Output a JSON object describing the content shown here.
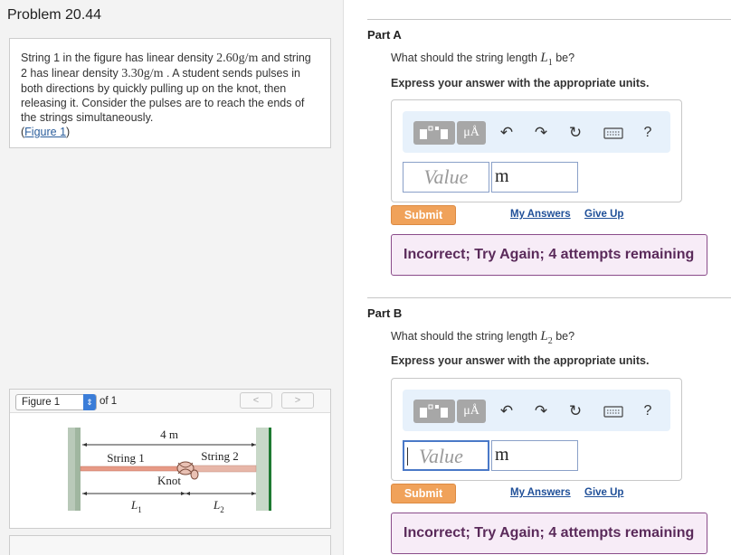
{
  "problem": {
    "title": "Problem 20.44",
    "text_1": "String 1 in the figure has linear density ",
    "density_1": "2.60g/m",
    "text_2": " and string 2 has linear density ",
    "density_2": "3.30g/m",
    "text_3": " . A student sends pulses in both directions by quickly pulling up on the knot, then releasing it. Consider the pulses are to reach the ends of the strings simultaneously.",
    "figure_link": "Figure 1"
  },
  "figure_panel": {
    "selected": "Figure 1",
    "of_label": "of 1",
    "prev": "<",
    "next": ">",
    "length_label": "4 m",
    "string1_label": "String 1",
    "string2_label": "String 2",
    "knot_label": "Knot",
    "L1_label": "L",
    "L1_sub": "1",
    "L2_label": "L",
    "L2_sub": "2"
  },
  "part_a": {
    "title": "Part A",
    "question_pre": "What should the string length ",
    "var": "L",
    "var_sub": "1",
    "question_post": " be?",
    "express": "Express your answer with the appropriate units.",
    "value_placeholder": "Value",
    "unit_value": "m",
    "submit": "Submit",
    "my_answers": "My Answers",
    "give_up": "Give Up",
    "feedback": "Incorrect; Try Again; 4 attempts remaining"
  },
  "part_b": {
    "title": "Part B",
    "question_pre": "What should the string length ",
    "var": "L",
    "var_sub": "2",
    "question_post": " be?",
    "express": "Express your answer with the appropriate units.",
    "value_placeholder": "Value",
    "unit_value": "m",
    "submit": "Submit",
    "my_answers": "My Answers",
    "give_up": "Give Up",
    "feedback": "Incorrect; Try Again; 4 attempts remaining"
  },
  "toolbar": {
    "mu_label": "μÅ",
    "undo_icon": "undo-icon",
    "redo_icon": "redo-icon",
    "reset_icon": "reset-icon",
    "keyboard_icon": "keyboard-icon",
    "help_label": "?"
  }
}
